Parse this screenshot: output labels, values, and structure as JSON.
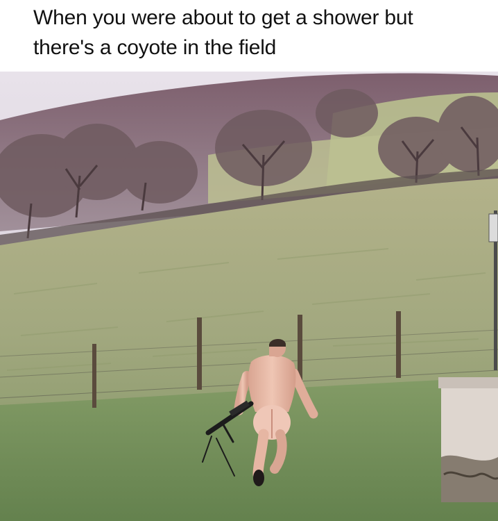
{
  "meme": {
    "caption_lines": [
      "When you were about to get a shower but",
      "there's a coyote in the field"
    ]
  },
  "photo": {
    "alt": "",
    "scene_elements": [
      "hillside-field",
      "bare-trees",
      "wire-fence",
      "running-man",
      "rifle",
      "concrete-wall"
    ]
  },
  "colors": {
    "sky": "#d9d4dc",
    "grass_far": "#b7b58e",
    "grass_mid": "#98a27a",
    "grass_near": "#6d8a57",
    "hill": "#8a6a78",
    "skin": "#e3b7a3"
  }
}
